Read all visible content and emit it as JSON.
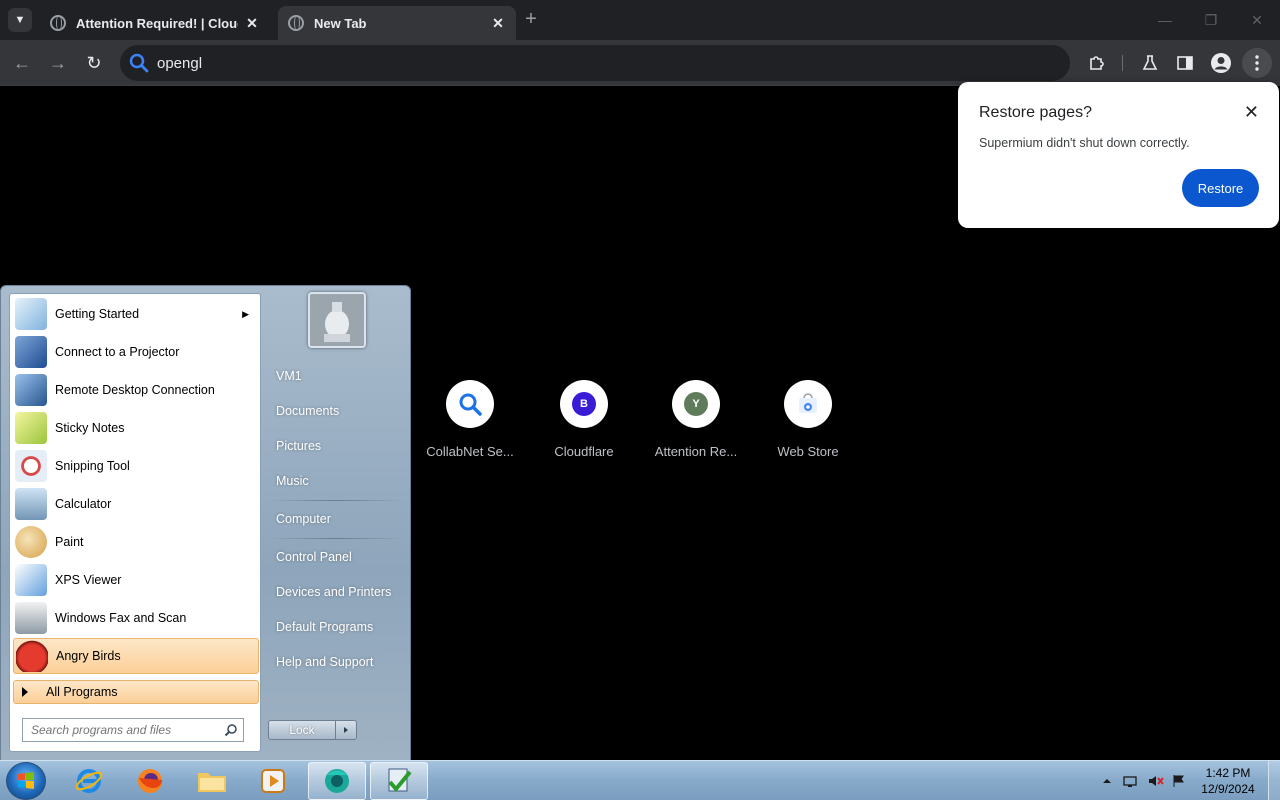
{
  "browser": {
    "tabs": [
      {
        "title": "Attention Required! | Cloudflare"
      },
      {
        "title": "New Tab"
      }
    ],
    "omnibox_text": "opengl"
  },
  "restore_bubble": {
    "title": "Restore pages?",
    "message": "Supermium didn't shut down correctly.",
    "button": "Restore"
  },
  "shortcuts": [
    {
      "label": "CollabNet Se...",
      "letter": "",
      "color": "#1a73e8"
    },
    {
      "label": "Cloudflare",
      "letter": "B",
      "color": "#3a1bd6"
    },
    {
      "label": "Attention Re...",
      "letter": "Y",
      "color": "#5f7b5c"
    },
    {
      "label": "Web Store",
      "letter": "",
      "color": "#4285f4"
    }
  ],
  "start_menu": {
    "programs": [
      {
        "label": "Getting Started",
        "has_submenu": true
      },
      {
        "label": "Connect to a Projector"
      },
      {
        "label": "Remote Desktop Connection"
      },
      {
        "label": "Sticky Notes"
      },
      {
        "label": "Snipping Tool"
      },
      {
        "label": "Calculator"
      },
      {
        "label": "Paint"
      },
      {
        "label": "XPS Viewer"
      },
      {
        "label": "Windows Fax and Scan"
      },
      {
        "label": "Angry Birds",
        "highlighted": true
      }
    ],
    "all_programs": "All Programs",
    "search_placeholder": "Search programs and files",
    "right_links": [
      "VM1",
      "Documents",
      "Pictures",
      "Music",
      "Computer",
      "Control Panel",
      "Devices and Printers",
      "Default Programs",
      "Help and Support"
    ],
    "lock_label": "Lock"
  },
  "taskbar": {
    "apps": [
      "internet-explorer",
      "firefox",
      "file-explorer",
      "media-player",
      "supermium",
      "task-app"
    ],
    "clock_time": "1:42 PM",
    "clock_date": "12/9/2024"
  }
}
